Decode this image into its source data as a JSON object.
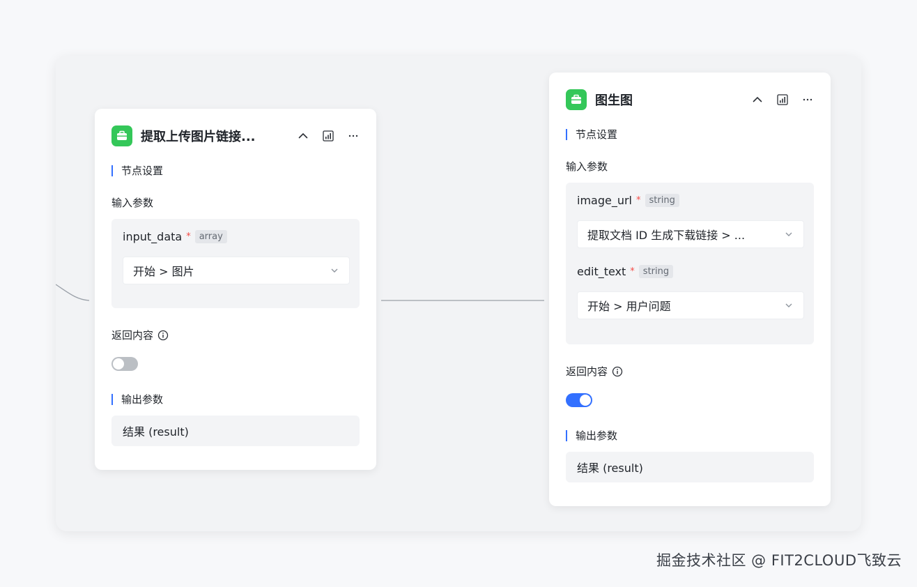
{
  "node_left": {
    "title": "提取上传图片链接...",
    "node_settings_label": "节点设置",
    "input_params_label": "输入参数",
    "params": [
      {
        "name": "input_data",
        "required_mark": "*",
        "type": "array",
        "value": "开始 > 图片"
      }
    ],
    "return_content_label": "返回内容",
    "return_content_enabled": false,
    "output_params_label": "输出参数",
    "output_result": "结果 (result)"
  },
  "node_right": {
    "title": "图生图",
    "node_settings_label": "节点设置",
    "input_params_label": "输入参数",
    "params": [
      {
        "name": "image_url",
        "required_mark": "*",
        "type": "string",
        "value": "提取文档 ID 生成下载链接 > ..."
      },
      {
        "name": "edit_text",
        "required_mark": "*",
        "type": "string",
        "value": "开始 > 用户问题"
      }
    ],
    "return_content_label": "返回内容",
    "return_content_enabled": true,
    "output_params_label": "输出参数",
    "output_result": "结果 (result)"
  },
  "icons": {
    "app": "toolbox-icon",
    "collapse": "chevron-up-icon",
    "chart": "chart-icon",
    "more": "more-icon",
    "info": "info-icon",
    "dropdown": "chevron-down-icon"
  },
  "colors": {
    "app_icon_green": "#34c759",
    "accent_blue": "#3370ff",
    "required_red": "#f54a45"
  },
  "watermark": "掘金技术社区 @ FIT2CLOUD飞致云"
}
